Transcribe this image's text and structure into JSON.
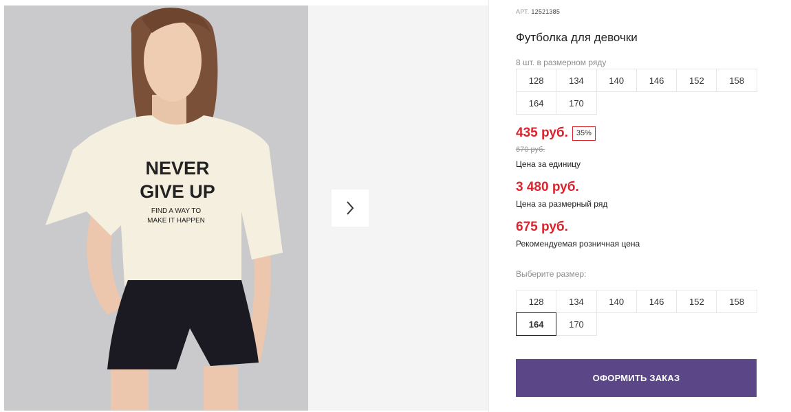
{
  "gallery": {
    "shirt_text": {
      "line1": "NEVER",
      "line2": "GIVE UP",
      "line3": "FIND A WAY TO",
      "line4": "MAKE IT HAPPEN"
    },
    "next_icon": "chevron-right-icon"
  },
  "product": {
    "art_label": "АРТ.",
    "art_value": "12521385",
    "title": "Футболка для девочки",
    "pack_label": "8 шт. в размерном ряду",
    "pack_sizes": [
      "128",
      "134",
      "140",
      "146",
      "152",
      "158",
      "164",
      "170"
    ],
    "price": "435 руб.",
    "discount": "35%",
    "old_price": "670 руб.",
    "unit_caption": "Цена за единицу",
    "row_price": "3 480 руб.",
    "row_caption": "Цена за размерный ряд",
    "rrp_price": "675 руб.",
    "rrp_caption": "Рекомендуемая розничная цена",
    "choose_label": "Выберите размер:",
    "choose_sizes": [
      "128",
      "134",
      "140",
      "146",
      "152",
      "158",
      "164",
      "170"
    ],
    "selected_size": "164",
    "order_button": "ОФОРМИТЬ ЗАКАЗ"
  },
  "colors": {
    "price_red": "#d9242e",
    "button_purple": "#5b4788",
    "photo_bg": "#c9c9cb"
  }
}
